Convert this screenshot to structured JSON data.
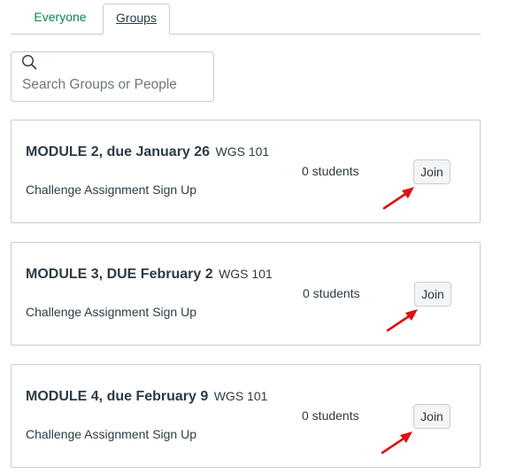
{
  "tabs": [
    {
      "label": "Everyone"
    },
    {
      "label": "Groups"
    }
  ],
  "search": {
    "placeholder": "Search Groups or People",
    "value": ""
  },
  "groups": [
    {
      "title": "MODULE 2, due January 26",
      "course": "WGS 101",
      "category": "Challenge Assignment Sign Up",
      "count": "0 students",
      "join_label": "Join"
    },
    {
      "title": "MODULE 3, DUE February 2",
      "course": "WGS 101",
      "category": "Challenge Assignment Sign Up",
      "count": "0 students",
      "join_label": "Join"
    },
    {
      "title": "MODULE 4, due February 9",
      "course": "WGS 101",
      "category": "Challenge Assignment Sign Up",
      "count": "0 students",
      "join_label": "Join"
    }
  ],
  "colors": {
    "accent_green": "#0b874b",
    "annotation_arrow": "#e01010",
    "text": "#2d3b45",
    "border": "#c7cdd1"
  },
  "icons": {
    "search": "search-icon",
    "annotation": "red-arrow-icon"
  }
}
